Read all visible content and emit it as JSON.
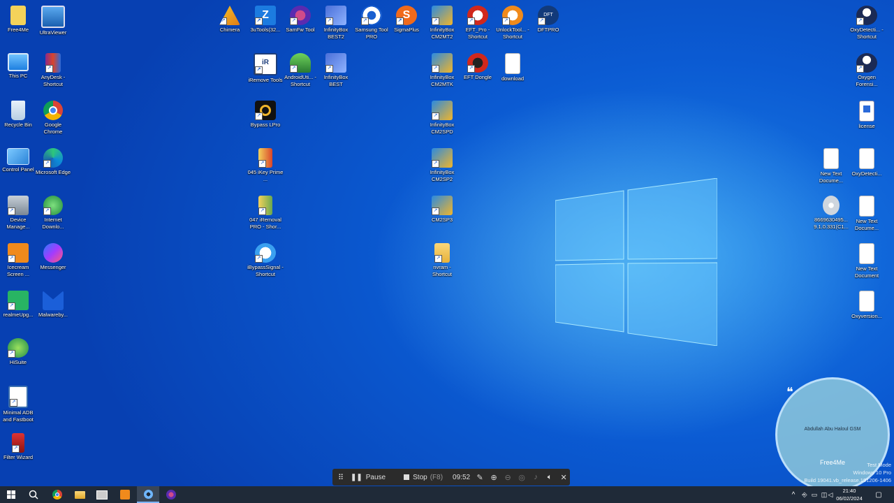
{
  "desktop_icons": [
    {
      "label": "Free4Me",
      "kind": "doc-yellow"
    },
    {
      "label": "UltraViewer",
      "kind": "monitor"
    },
    {
      "label": "This PC",
      "kind": "monitor"
    },
    {
      "label": "AnyDesk - Shortcut",
      "kind": "rar"
    },
    {
      "label": "Recycle Bin",
      "kind": "bin"
    },
    {
      "label": "Google Chrome",
      "kind": "chrome"
    },
    {
      "label": "Control Panel",
      "kind": "panel"
    },
    {
      "label": "Microsoft Edge",
      "kind": "edge"
    },
    {
      "label": "Device Manage...",
      "kind": "device"
    },
    {
      "label": "Internet Downlo...",
      "kind": "idm"
    },
    {
      "label": "Icecream Screen ...",
      "kind": "orange"
    },
    {
      "label": "Messenger",
      "kind": "messenger"
    },
    {
      "label": "realmeUpg...",
      "kind": "green"
    },
    {
      "label": "Malwareby...",
      "kind": "malware"
    },
    {
      "label": "HiSuite",
      "kind": "hisuite"
    },
    {
      "label": "Minimal ADB and Fastboot",
      "kind": "adb"
    },
    {
      "label": "Filter Wizard",
      "kind": "filter"
    },
    {
      "label": "Chimera",
      "kind": "chimera"
    },
    {
      "label": "3uTools(32...",
      "kind": "3u"
    },
    {
      "label": "SamFw Tool",
      "kind": "samfw"
    },
    {
      "label": "InfinityBox BEST2",
      "kind": "infinity"
    },
    {
      "label": "Samsung Tool PRO",
      "kind": "gear"
    },
    {
      "label": "SigmaPlus",
      "kind": "sigma"
    },
    {
      "label": "InfinityBox CM2MT2",
      "kind": "infinity-small"
    },
    {
      "label": "EFT_Pro - Shortcut",
      "kind": "eft"
    },
    {
      "label": "UnlockTool... - Shortcut",
      "kind": "unlock"
    },
    {
      "label": "DFTPRO",
      "kind": "dft"
    },
    {
      "label": "iRemove Tools",
      "kind": "iremove"
    },
    {
      "label": "AndroidUti... - Shortcut",
      "kind": "android"
    },
    {
      "label": "InfinityBox BEST",
      "kind": "infinity"
    },
    {
      "label": "InfinityBox CM2MTK",
      "kind": "infinity-small"
    },
    {
      "label": "EFT Dongle",
      "kind": "eft"
    },
    {
      "label": "download",
      "kind": "file"
    },
    {
      "label": "Bypass LPro",
      "kind": "bypass"
    },
    {
      "label": "InfinityBox CM2SPD",
      "kind": "infinity-small"
    },
    {
      "label": "045 iKey Prime ...",
      "kind": "zip"
    },
    {
      "label": "InfinityBox CM2SP2",
      "kind": "infinity-small"
    },
    {
      "label": "047 iRemoval PRO - Shor...",
      "kind": "zip"
    },
    {
      "label": "CM2SP3",
      "kind": "infinity-small"
    },
    {
      "label": "iBypassSignal - Shortcut",
      "kind": "cloud"
    },
    {
      "label": "nvram - Shortcut",
      "kind": "folder"
    },
    {
      "label": "OxyDetecti... - Shortcut",
      "kind": "oxy"
    },
    {
      "label": "Oxygen Forensi...",
      "kind": "oxy"
    },
    {
      "label": "license",
      "kind": "license"
    },
    {
      "label": "New Text Docume...",
      "kind": "file"
    },
    {
      "label": "OxyDetecti...",
      "kind": "file"
    },
    {
      "label": "8669630495... 9.1.0.331(C1...",
      "kind": "disc"
    },
    {
      "label": "New Text Docume...",
      "kind": "file"
    },
    {
      "label": "New Text Document",
      "kind": "file"
    },
    {
      "label": "Oxyversion...",
      "kind": "file"
    }
  ],
  "recorder": {
    "pause_label": "Pause",
    "stop_label": "Stop",
    "stop_key": "(F8)",
    "elapsed": "09:52"
  },
  "watermark": {
    "name": "Abdullah Abu Haloul GSM",
    "brand": "Free4Me"
  },
  "system_notice": {
    "line1": "Test Mode",
    "line2": "Windows 10 Pro",
    "line3": "Build 19041.vb_release.191206-1406"
  },
  "clock": {
    "time": "21:40",
    "date": "06/02/2024"
  },
  "colors": {
    "desktop": "#0b5bd3",
    "taskbar": "#1f2a38",
    "accent": "#7fb6ff"
  }
}
